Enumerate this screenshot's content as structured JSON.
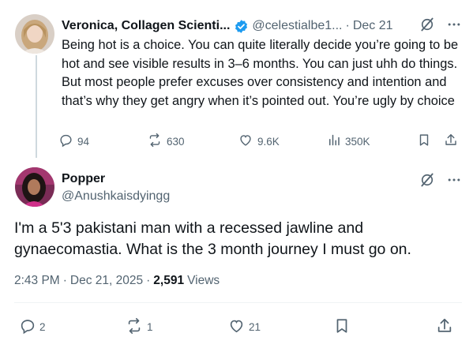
{
  "tweet1": {
    "author_name": "Veronica, Collagen Scienti...",
    "handle": "@celestialbe1...",
    "separator": "·",
    "date": "Dec 21",
    "text": "Being hot is a choice. You can quite literally decide you’re going to be hot and see visible results in 3–6 months. You can just uhh do things. But most people prefer excuses over consistency and intention and that’s why they get angry when it’s pointed out. You’re ugly by choice",
    "actions": {
      "replies": "94",
      "reposts": "630",
      "likes": "9.6K",
      "views": "350K"
    },
    "colors": {
      "verified": "#1d9bf0",
      "muted": "#536471"
    }
  },
  "tweet2": {
    "author_name": "Popper",
    "handle": "@Anushkaisdyingg",
    "text": "I'm a 5'3 pakistani man with a recessed jawline and gynaecomastia. What is the 3 month journey I must go on.",
    "time": "2:43 PM",
    "sep1": "·",
    "date": "Dec 21, 2025",
    "sep2": "·",
    "views_count": "2,591",
    "views_label": "Views",
    "actions": {
      "replies": "2",
      "reposts": "1",
      "likes": "21"
    }
  },
  "icons": {
    "verified": "verified-badge-icon",
    "grok": "grok-icon",
    "more": "more-icon",
    "reply": "reply-icon",
    "repost": "repost-icon",
    "like": "like-icon",
    "views": "views-icon",
    "bookmark": "bookmark-icon",
    "share": "share-icon"
  }
}
